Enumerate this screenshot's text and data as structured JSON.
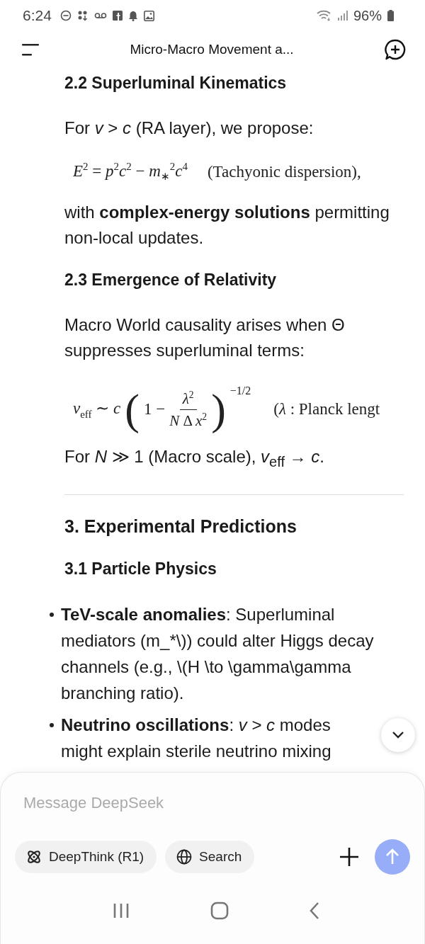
{
  "status_bar": {
    "time": "6:24",
    "battery": "96%"
  },
  "header": {
    "title": "Micro-Macro Movement a..."
  },
  "content": [
    {
      "kind": "h3",
      "text": "2.2 Superluminal Kinematics"
    },
    {
      "kind": "p",
      "text": "For *v* > *c* (RA layer), we propose:"
    },
    {
      "kind": "eq",
      "math": "*E*$^{2}$ = *p*$^{2}$*c*$^{2}$ − *m*$_{∗}$$^{2}$*c*$^{4}$",
      "note": "(Tachyonic dispersion),"
    },
    {
      "kind": "p",
      "text": "with **complex-energy solutions** permitting non-local updates."
    },
    {
      "kind": "h3",
      "text": "2.3 Emergence of Relativity"
    },
    {
      "kind": "p",
      "text": "Macro World causality arises when Θ suppresses superluminal terms:"
    },
    {
      "kind": "frac",
      "lhs": "*v*$_{eff}$ ∼ *c*",
      "open": "(",
      "lead": "1 −",
      "numerator": "*λ*$^{2}$",
      "denominator": "*N* Δ *x*$^{2}$",
      "close": ")",
      "exponent": "−1/2",
      "note": "(*λ* :  Planck lengt"
    },
    {
      "kind": "p",
      "text": "For *N* ≫ 1 (Macro scale), *v*$_{eff}$ → *c*."
    },
    {
      "kind": "hr"
    },
    {
      "kind": "h2",
      "text": "3. Experimental Predictions"
    },
    {
      "kind": "h3",
      "text": "3.1 Particle Physics"
    },
    {
      "kind": "li",
      "text": "**TeV-scale anomalies**: Superluminal mediators (m_*\\)) could alter Higgs decay channels (e.g., \\(H \\to \\gamma\\gamma branching ratio)."
    },
    {
      "kind": "li",
      "text": "**Neutrino oscillations**: *v* > *c* modes might explain sterile neutrino mixing"
    }
  ],
  "composer": {
    "placeholder": "Message DeepSeek",
    "chips": [
      {
        "kind": "think",
        "label": "DeepThink (R1)",
        "selected": false
      },
      {
        "kind": "search",
        "label": "Search",
        "selected": false
      }
    ]
  }
}
